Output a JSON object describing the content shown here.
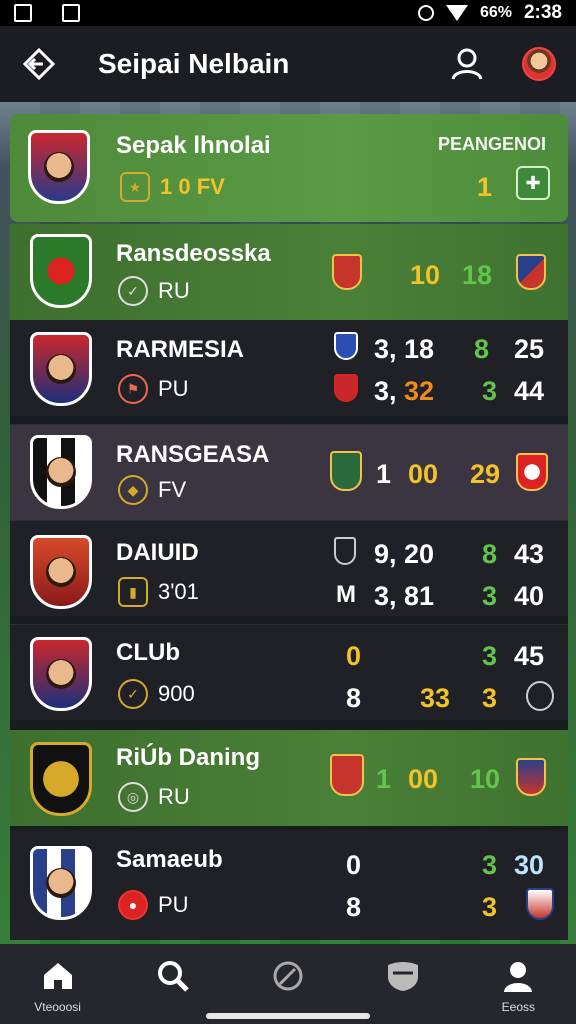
{
  "status_bar": {
    "battery": "66%",
    "time": "2:38"
  },
  "header": {
    "title": "Seipai Nelbain"
  },
  "featured": {
    "team_name": "Sepak lhnolai",
    "sub_label": "1 0 FV",
    "right_label": "PEANGENOI",
    "score": "1"
  },
  "rows": [
    {
      "name": "Ransdeosska",
      "sub": "RU",
      "col1": "10",
      "col2": "18"
    },
    {
      "name": "RARMESIA",
      "sub": "PU",
      "line1": [
        "3, 18",
        "8",
        "25"
      ],
      "line2": [
        "3, 32",
        "3",
        "44"
      ]
    },
    {
      "name": "RANSGEASA",
      "sub": "FV",
      "col0": "1",
      "col1": "00",
      "col2": "29"
    },
    {
      "name": "DAIUID",
      "sub": "3'01",
      "line1": [
        "9, 20",
        "8",
        "43"
      ],
      "line2_pre": "M",
      "line2": [
        "3, 81",
        "3",
        "40"
      ]
    },
    {
      "name": "CLUb",
      "sub": "900",
      "line1_pre": "0",
      "line1": [
        "3",
        "45"
      ],
      "line2": [
        "8",
        "33",
        "3"
      ]
    },
    {
      "name": "RiÚb Daning",
      "sub": "RU",
      "col0": "1",
      "col1": "00",
      "col2": "10"
    },
    {
      "name": "Samaeub",
      "sub": "PU",
      "line1_pre": "0",
      "line1": [
        "3",
        "30"
      ],
      "line2": [
        "8",
        "3"
      ]
    }
  ],
  "nav": [
    {
      "label": "Vteooosi",
      "icon": "home-icon"
    },
    {
      "label": "",
      "icon": "search-icon"
    },
    {
      "label": "",
      "icon": "ball-icon"
    },
    {
      "label": "",
      "icon": "shield-icon"
    },
    {
      "label": "Eeoss",
      "icon": "profile-icon"
    }
  ],
  "colors": {
    "yellow": "#f2c326",
    "green": "#62c44a",
    "orange": "#f08a1e",
    "header_bg": "#1b1d22"
  }
}
